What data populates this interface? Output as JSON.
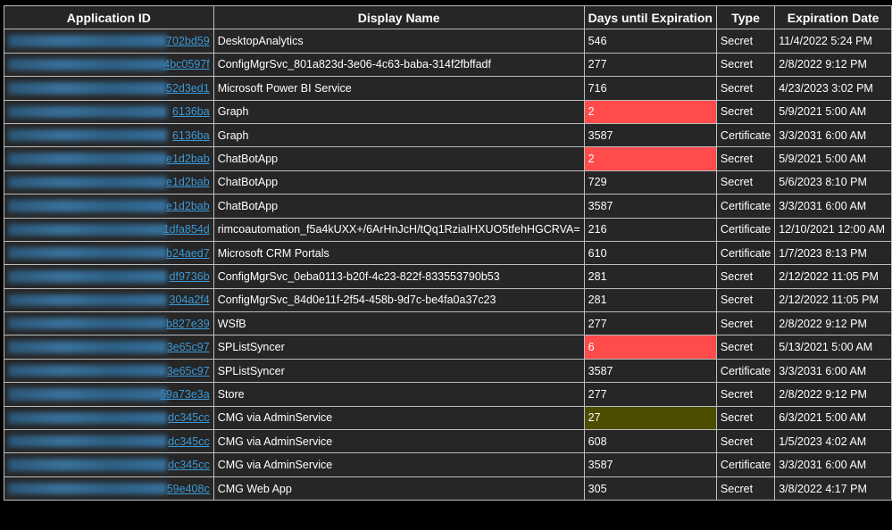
{
  "headers": [
    "Application ID",
    "Display Name",
    "Days until Expiration",
    "Type",
    "Expiration Date"
  ],
  "rows": [
    {
      "id": "702bd59",
      "name": "DesktopAnalytics",
      "days": "546",
      "type": "Secret",
      "date": "11/4/2022 5:24 PM",
      "highlight": ""
    },
    {
      "id": "4bc0597f",
      "name": "ConfigMgrSvc_801a823d-3e06-4c63-baba-314f2fbffadf",
      "days": "277",
      "type": "Secret",
      "date": "2/8/2022 9:12 PM",
      "highlight": ""
    },
    {
      "id": "52d3ed1",
      "name": "Microsoft Power BI Service",
      "days": "716",
      "type": "Secret",
      "date": "4/23/2023 3:02 PM",
      "highlight": ""
    },
    {
      "id": "6136ba",
      "name": "Graph",
      "days": "2",
      "type": "Secret",
      "date": "5/9/2021 5:00 AM",
      "highlight": "red"
    },
    {
      "id": "6136ba",
      "name": "Graph",
      "days": "3587",
      "type": "Certificate",
      "date": "3/3/2031 6:00 AM",
      "highlight": ""
    },
    {
      "id": "e1d2bab",
      "name": "ChatBotApp",
      "days": "2",
      "type": "Secret",
      "date": "5/9/2021 5:00 AM",
      "highlight": "red"
    },
    {
      "id": "e1d2bab",
      "name": "ChatBotApp",
      "days": "729",
      "type": "Secret",
      "date": "5/6/2023 8:10 PM",
      "highlight": ""
    },
    {
      "id": "e1d2bab",
      "name": "ChatBotApp",
      "days": "3587",
      "type": "Certificate",
      "date": "3/3/2031 6:00 AM",
      "highlight": ""
    },
    {
      "id": "1dfa854d",
      "name": "rimcoautomation_f5a4kUXX+/6ArHnJcH/tQq1RziaIHXUO5tfehHGCRVA=",
      "days": "216",
      "type": "Certificate",
      "date": "12/10/2021 12:00 AM",
      "highlight": ""
    },
    {
      "id": "b24aed7",
      "name": "Microsoft CRM Portals",
      "days": "610",
      "type": "Certificate",
      "date": "1/7/2023 8:13 PM",
      "highlight": ""
    },
    {
      "id": "df9736b",
      "name": "ConfigMgrSvc_0eba0113-b20f-4c23-822f-833553790b53",
      "days": "281",
      "type": "Secret",
      "date": "2/12/2022 11:05 PM",
      "highlight": ""
    },
    {
      "id": "304a2f4",
      "name": "ConfigMgrSvc_84d0e11f-2f54-458b-9d7c-be4fa0a37c23",
      "days": "281",
      "type": "Secret",
      "date": "2/12/2022 11:05 PM",
      "highlight": ""
    },
    {
      "id": "b827e39",
      "name": "WSfB",
      "days": "277",
      "type": "Secret",
      "date": "2/8/2022 9:12 PM",
      "highlight": ""
    },
    {
      "id": "3e65c97",
      "name": "SPListSyncer",
      "days": "6",
      "type": "Secret",
      "date": "5/13/2021 5:00 AM",
      "highlight": "red"
    },
    {
      "id": "3e65c97",
      "name": "SPListSyncer",
      "days": "3587",
      "type": "Certificate",
      "date": "3/3/2031 6:00 AM",
      "highlight": ""
    },
    {
      "id": "59a73e3a",
      "name": "Store",
      "days": "277",
      "type": "Secret",
      "date": "2/8/2022 9:12 PM",
      "highlight": ""
    },
    {
      "id": "dc345cc",
      "name": "CMG via AdminService",
      "days": "27",
      "type": "Secret",
      "date": "6/3/2021 5:00 AM",
      "highlight": "olive"
    },
    {
      "id": "dc345cc",
      "name": "CMG via AdminService",
      "days": "608",
      "type": "Secret",
      "date": "1/5/2023 4:02 AM",
      "highlight": ""
    },
    {
      "id": "dc345cc",
      "name": "CMG via AdminService",
      "days": "3587",
      "type": "Certificate",
      "date": "3/3/2031 6:00 AM",
      "highlight": ""
    },
    {
      "id": "59e408c",
      "name": "CMG Web App",
      "days": "305",
      "type": "Secret",
      "date": "3/8/2022 4:17 PM",
      "highlight": ""
    }
  ],
  "colors": {
    "background": "#262626",
    "border": "#bdbdbd",
    "link": "#3a9ad9",
    "expiring_critical": "#ff4b4b",
    "expiring_warning": "#4d4d00"
  }
}
